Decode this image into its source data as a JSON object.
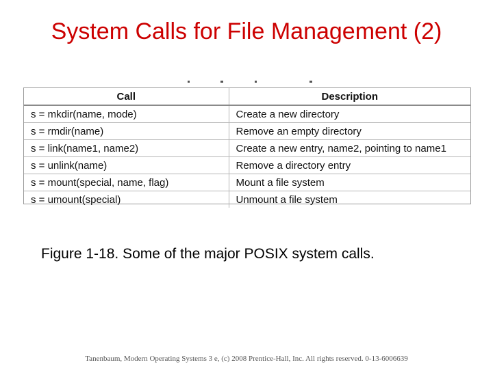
{
  "slide": {
    "title": "System Calls for File Management (2)",
    "table": {
      "headers": [
        "Call",
        "Description"
      ],
      "rows": [
        {
          "call": "s = mkdir(name, mode)",
          "description": "Create a new directory"
        },
        {
          "call": "s = rmdir(name)",
          "description": "Remove an empty directory"
        },
        {
          "call": "s = link(name1, name2)",
          "description": "Create a new entry, name2, pointing to name1"
        },
        {
          "call": "s = unlink(name)",
          "description": "Remove a directory entry"
        },
        {
          "call": "s = mount(special, name, flag)",
          "description": "Mount a file system"
        },
        {
          "call": "s = umount(special)",
          "description": "Unmount a file system"
        }
      ]
    },
    "caption": "Figure 1-18. Some of the major POSIX system calls.",
    "footer": "Tanenbaum, Modern Operating Systems 3 e, (c) 2008 Prentice-Hall, Inc. All rights reserved. 0-13-6006639"
  },
  "colors": {
    "title": "#cc0000",
    "text": "#111111",
    "grid": "#b5b5b5",
    "footer": "#555555"
  }
}
